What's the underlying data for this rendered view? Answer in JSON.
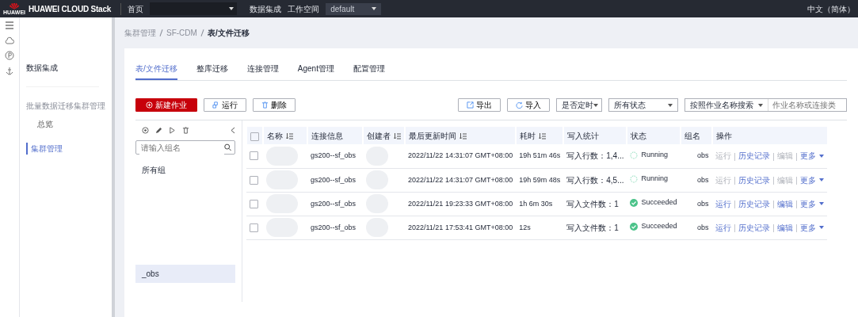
{
  "topbar": {
    "brand": "HUAWEI CLOUD Stack",
    "logo_caption": "HUAWEI",
    "home": "首页",
    "menus": [
      "数据集成",
      "工作空间"
    ],
    "workspace": "default",
    "language": "中文（简体）"
  },
  "sidebar": {
    "title": "数据集成",
    "section": "批量数据迁移集群管理",
    "items": [
      {
        "label": "总览",
        "selected": false
      },
      {
        "label": "集群管理",
        "selected": true
      }
    ]
  },
  "breadcrumb": [
    "集群管理",
    "SF-CDM",
    "表/文件迁移"
  ],
  "tabs": [
    {
      "label": "表/文件迁移",
      "selected": true
    },
    {
      "label": "整库迁移",
      "selected": false
    },
    {
      "label": "连接管理",
      "selected": false
    },
    {
      "label": "Agent管理",
      "selected": false
    },
    {
      "label": "配置管理",
      "selected": false
    }
  ],
  "buttons": [
    {
      "label": "新建作业",
      "kind": "primary"
    },
    {
      "label": "运行",
      "kind": "run"
    },
    {
      "label": "删除",
      "kind": "delete"
    }
  ],
  "tools": [
    {
      "label": "导出",
      "kind": "export"
    },
    {
      "label": "导入",
      "kind": "import"
    }
  ],
  "filters": [
    "是否定时",
    "所有状态"
  ],
  "search": {
    "scope": "按照作业名称搜索",
    "placeholder": "作业名称或连接类"
  },
  "groups": {
    "placeholder": "请输入组名",
    "items": [
      {
        "label": "所有组",
        "selected": false
      },
      {
        "label": "_obs",
        "selected": true
      }
    ]
  },
  "table": {
    "select_all": {
      "checked": false
    },
    "columns": [
      {
        "label": "名称",
        "sortable": true
      },
      {
        "label": "连接信息",
        "sortable": false
      },
      {
        "label": "创建者",
        "sortable": true
      },
      {
        "label": "最后更新时间",
        "sortable": true
      },
      {
        "label": "耗时",
        "sortable": true
      },
      {
        "label": "写入统计",
        "sortable": false
      },
      {
        "label": "状态",
        "sortable": false
      },
      {
        "label": "组名",
        "sortable": false
      },
      {
        "label": "操作",
        "sortable": false
      }
    ],
    "rows": [
      {
        "checked": false,
        "connection": "gs200--sf_obs",
        "updated": "2022/11/22 14:31:07 GMT+08:00",
        "duration": "19h 51m 46s",
        "stats": "写入行数：1,4...",
        "status": {
          "kind": "running",
          "label": "Running"
        },
        "group": "obs",
        "actions": [
          {
            "label": "运行",
            "disabled": true
          },
          {
            "label": "历史记录",
            "disabled": false
          },
          {
            "label": "编辑",
            "disabled": true
          }
        ],
        "more": "更多"
      },
      {
        "checked": false,
        "connection": "gs200--sf_obs",
        "updated": "2022/11/22 14:31:07 GMT+08:00",
        "duration": "19h 59m 48s",
        "stats": "写入行数：4,5...",
        "status": {
          "kind": "running",
          "label": "Running"
        },
        "group": "obs",
        "actions": [
          {
            "label": "运行",
            "disabled": true
          },
          {
            "label": "历史记录",
            "disabled": false
          },
          {
            "label": "编辑",
            "disabled": true
          }
        ],
        "more": "更多"
      },
      {
        "checked": false,
        "connection": "gs200--sf_obs",
        "updated": "2022/11/21 19:23:33 GMT+08:00",
        "duration": "1h 6m 30s",
        "stats": "写入文件数：1",
        "status": {
          "kind": "succeeded",
          "label": "Succeeded"
        },
        "group": "obs",
        "actions": [
          {
            "label": "运行",
            "disabled": false
          },
          {
            "label": "历史记录",
            "disabled": false
          },
          {
            "label": "编辑",
            "disabled": false
          }
        ],
        "more": "更多"
      },
      {
        "checked": false,
        "connection": "gs200--sf_obs",
        "updated": "2022/11/21 17:53:41 GMT+08:00",
        "duration": "12s",
        "stats": "写入文件数：1",
        "status": {
          "kind": "succeeded",
          "label": "Succeeded"
        },
        "group": "obs",
        "actions": [
          {
            "label": "运行",
            "disabled": false
          },
          {
            "label": "历史记录",
            "disabled": false
          },
          {
            "label": "编辑",
            "disabled": false
          }
        ],
        "more": "更多"
      }
    ]
  }
}
